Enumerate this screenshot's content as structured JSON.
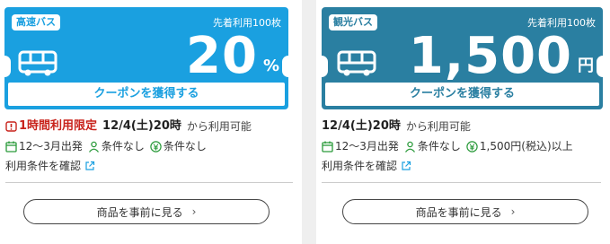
{
  "coupons": [
    {
      "tag": "高速バス",
      "limit_text": "先着利用100枚",
      "amount": "20",
      "unit": "%",
      "get_label": "クーポンを獲得する",
      "limited_label": "1時間利用限定",
      "start": "12/4(土)20時",
      "start_suffix": "から利用可能",
      "departure": "12～3月出発",
      "condition_person": "条件なし",
      "condition_price": "条件なし",
      "terms_link": "利用条件を確認",
      "preview_label": "商品を事前に見る",
      "color": "#1aa0e0"
    },
    {
      "tag": "観光バス",
      "limit_text": "先着利用100枚",
      "amount": "1,500",
      "unit": "円",
      "get_label": "クーポンを獲得する",
      "start": "12/4(土)20時",
      "start_suffix": "から利用可能",
      "departure": "12～3月出発",
      "condition_person": "条件なし",
      "condition_price": "1,500円(税込)以上",
      "terms_link": "利用条件を確認",
      "preview_label": "商品を事前に見る",
      "color": "#2a7fa1"
    }
  ],
  "icons": {
    "bus": "bus-icon",
    "alert": "alert-icon",
    "calendar": "calendar-icon",
    "person": "person-icon",
    "yen": "yen-icon",
    "external": "external-link-icon",
    "chevron": "chevron-right-icon"
  }
}
